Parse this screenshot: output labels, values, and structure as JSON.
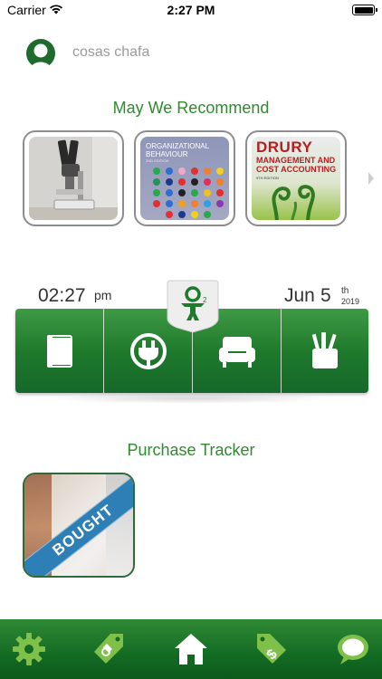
{
  "status_bar": {
    "carrier": "Carrier",
    "time": "2:27 PM",
    "battery": 1.0
  },
  "profile": {
    "name": "cosas chafa"
  },
  "recommend": {
    "title": "May We Recommend",
    "items": [
      {
        "kind": "photo",
        "icon": "microscope-photo"
      },
      {
        "kind": "book",
        "title_line1": "ORGANIZATIONAL",
        "title_line2": "BEHAVIOUR",
        "subtitle": "2ND EDITION"
      },
      {
        "kind": "book",
        "title": "DRURY",
        "subtitle_line1": "MANAGEMENT AND",
        "subtitle_line2": "COST ACCOUNTING",
        "edition": "9TH EDITION"
      }
    ]
  },
  "clock": {
    "time": "02:27",
    "ampm": "pm",
    "month": "Jun",
    "day": "5",
    "suffix": "th",
    "year": "2019"
  },
  "categories": [
    {
      "icon": "book-icon"
    },
    {
      "icon": "plug-icon"
    },
    {
      "icon": "armchair-icon"
    },
    {
      "icon": "supplies-icon"
    }
  ],
  "tracker": {
    "title": "Purchase Tracker",
    "items": [
      {
        "badge": "BOUGHT"
      }
    ]
  },
  "tab_bar": {
    "tabs": [
      {
        "icon": "gear-icon"
      },
      {
        "icon": "price-tag-icon"
      },
      {
        "icon": "home-icon"
      },
      {
        "icon": "dollar-tag-icon"
      },
      {
        "icon": "chat-icon"
      }
    ]
  },
  "colors": {
    "accent": "#2e8b2e",
    "bar_green": "#1f7a2c",
    "ribbon_blue": "#2d7fb6"
  }
}
